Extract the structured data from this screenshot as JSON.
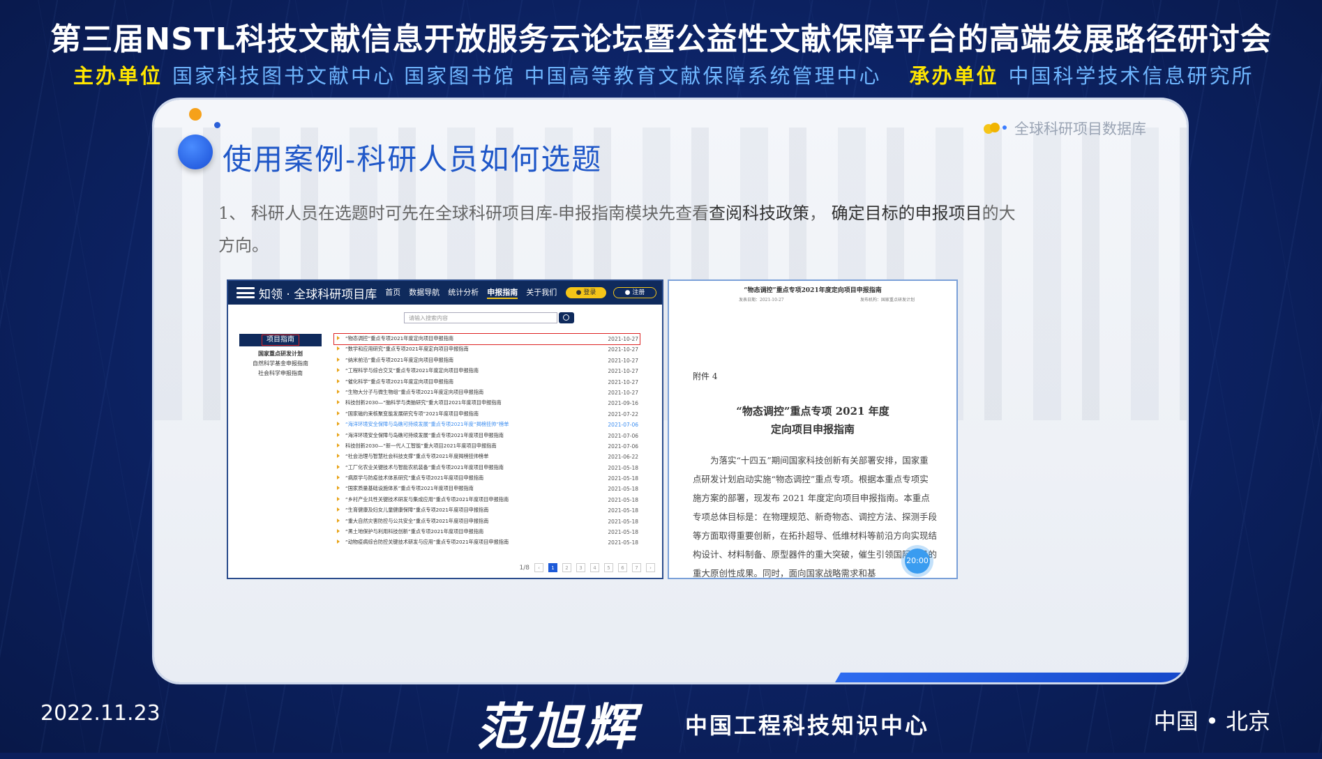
{
  "header": {
    "title": "第三届NSTL科技文献信息开放服务云论坛暨公益性文献保障平台的高端发展路径研讨会",
    "host_label": "主办单位",
    "hosts": "国家科技图书文献中心 国家图书馆 中国高等教育文献保障系统管理中心",
    "organizer_label": "承办单位",
    "organizer": "中国科学技术信息研究所"
  },
  "slide": {
    "title": "使用案例-科研人员如何选题",
    "tag": "全球科研项目数据库",
    "para_prefix": "1、 科研人员在选题时可先在全球科研项目库-申报指南模块先查看",
    "para_hl1": "查阅科技政策",
    "para_mid": "， ",
    "para_hl2": "确定目标的申报项目",
    "para_suffix": "的大方向。"
  },
  "portal": {
    "brand": "知领 · 全球科研项目库",
    "nav": [
      "首页",
      "数据导航",
      "统计分析",
      "申报指南",
      "关于我们"
    ],
    "login": "登录",
    "register": "注册",
    "search_placeholder": "请输入搜索内容",
    "sidebar_head": "项目指南",
    "sidebar_items": [
      "国家重点研发计划",
      "自然科学基金申报指南",
      "社会科学申报指南"
    ],
    "rows": [
      {
        "title": "“物态调控”重点专项2021年度定向项目申报指南",
        "date": "2021-10-27"
      },
      {
        "title": "“数学和应用研究”重点专项2021年度定向项目申报指南",
        "date": "2021-10-27"
      },
      {
        "title": "“纳米前沿”重点专项2021年度定向项目申报指南",
        "date": "2021-10-27"
      },
      {
        "title": "“工程科学与综合交叉”重点专项2021年度定向项目申报指南",
        "date": "2021-10-27"
      },
      {
        "title": "“催化科学”重点专项2021年度定向项目申报指南",
        "date": "2021-10-27"
      },
      {
        "title": "“生物大分子与微生物组”重点专项2021年度定向项目申报指南",
        "date": "2021-10-27"
      },
      {
        "title": "科技创新2030—“脑科学与类脑研究”重大项目2021年度项目申报指南",
        "date": "2021-09-16"
      },
      {
        "title": "“国家磁约束核聚变能发展研究专项”2021年度项目申报指南",
        "date": "2021-07-22"
      },
      {
        "title": "“海洋环境安全保障与岛礁可持续发展”重点专项2021年度“揭榜挂帅”榜单",
        "date": "2021-07-06"
      },
      {
        "title": "“海洋环境安全保障与岛礁可持续发展”重点专项2021年度项目申报指南",
        "date": "2021-07-06"
      },
      {
        "title": "科技创新2030—“新一代人工智能”重大项目2021年度项目申报指南",
        "date": "2021-07-06"
      },
      {
        "title": "“社会治理与智慧社会科技支撑”重点专项2021年度揭榜挂帅榜单",
        "date": "2021-06-22"
      },
      {
        "title": "“工厂化农业关键技术与智能农机装备”重点专项2021年度项目申报指南",
        "date": "2021-05-18"
      },
      {
        "title": "“病原学与防疫技术体系研究”重点专项2021年度项目申报指南",
        "date": "2021-05-18"
      },
      {
        "title": "“国家质量基础设施体系”重点专项2021年度项目申报指南",
        "date": "2021-05-18"
      },
      {
        "title": "“乡村产业共性关键技术研发与集成应用”重点专项2021年度项目申报指南",
        "date": "2021-05-18"
      },
      {
        "title": "“生育健康及妇女儿童健康保障”重点专项2021年度项目申报指南",
        "date": "2021-05-18"
      },
      {
        "title": "“重大自然灾害防控与公共安全”重点专项2021年度项目申报指南",
        "date": "2021-05-18"
      },
      {
        "title": "“黑土地保护与利用科技创新”重点专项2021年度项目申报指南",
        "date": "2021-05-18"
      },
      {
        "title": "“动物疫病综合防控关键技术研发与应用”重点专项2021年度项目申报指南",
        "date": "2021-05-18"
      }
    ],
    "page_info": "1/8",
    "pages": [
      "‹",
      "1",
      "2",
      "3",
      "4",
      "5",
      "6",
      "7",
      "›"
    ]
  },
  "document": {
    "header": "“物态调控”重点专项2021年度定向项目申报指南",
    "meta_left": "发表日期：2021-10-27",
    "meta_right": "发布机构：国家重点研发计划",
    "attachment": "附件 4",
    "title1": "“物态调控”重点专项 2021 年度",
    "title2": "定向项目申报指南",
    "body": "为落实“十四五”期间国家科技创新有关部署安排，国家重点研发计划启动实施“物态调控”重点专项。根据本重点专项实施方案的部署，现发布 2021 年度定向项目申报指南。本重点专项总体目标是：在物理规范、新奇物态、调控方法、探测手段等方面取得重要创新，在拓扑超导、低维材料等前沿方向实现结构设计、材料制备、原型器件的重大突破，催生引领国际前沿的重大原创性成果。同时，面向国家战略需求和基",
    "timer": "20:00"
  },
  "footer": {
    "date": "2022.11.23",
    "speaker": "范旭辉",
    "org": "中国工程科技知识中心",
    "location": "中国 • 北京"
  }
}
